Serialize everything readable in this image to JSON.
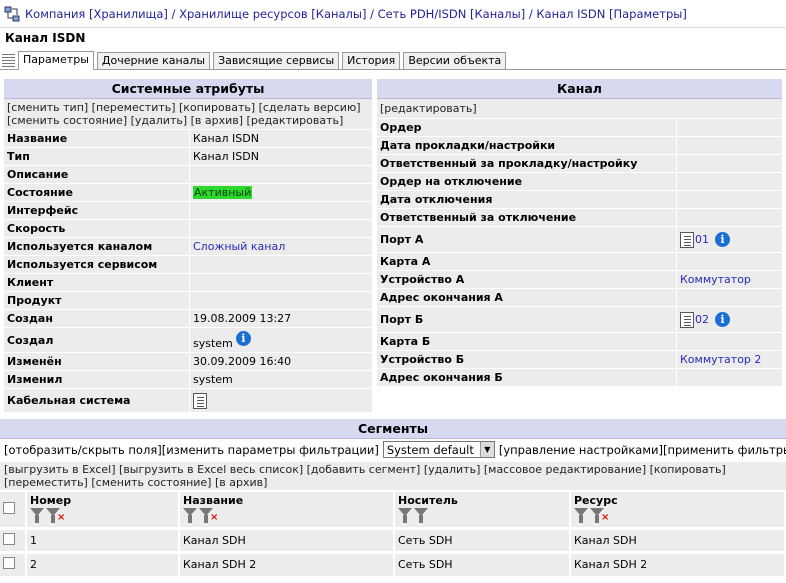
{
  "breadcrumb": "Компания [Хранилища] / Хранилище ресурсов [Каналы] / Сеть PDH/ISDN [Каналы] / Канал ISDN [Параметры]",
  "page_title": "Канал ISDN",
  "tabs": [
    {
      "label": "Параметры",
      "active": true
    },
    {
      "label": "Дочерние каналы",
      "active": false
    },
    {
      "label": "Зависящие сервисы",
      "active": false
    },
    {
      "label": "История",
      "active": false
    },
    {
      "label": "Версии объекта",
      "active": false
    }
  ],
  "sys": {
    "title": "Системные атрибуты",
    "actions_line1": "[сменить тип] [переместить] [копировать] [сделать версию]",
    "actions_line2": "[сменить состояние] [удалить] [в архив] [редактировать]",
    "rows": [
      {
        "label": "Название",
        "value": "Канал ISDN"
      },
      {
        "label": "Тип",
        "value": "Канал ISDN"
      },
      {
        "label": "Описание",
        "value": ""
      },
      {
        "label": "Состояние",
        "value": "Активный"
      },
      {
        "label": "Интерфейс",
        "value": ""
      },
      {
        "label": "Скорость",
        "value": ""
      },
      {
        "label": "Используется каналом",
        "value": "Сложный канал"
      },
      {
        "label": "Используется сервисом",
        "value": ""
      },
      {
        "label": "Клиент",
        "value": ""
      },
      {
        "label": "Продукт",
        "value": ""
      },
      {
        "label": "Создан",
        "value": "19.08.2009 13:27"
      },
      {
        "label": "Создал",
        "value": "system"
      },
      {
        "label": "Изменён",
        "value": "30.09.2009 16:40"
      },
      {
        "label": "Изменил",
        "value": "system"
      },
      {
        "label": "Кабельная система",
        "value": ""
      }
    ]
  },
  "chan": {
    "title": "Канал",
    "action": "[редактировать]",
    "rows": [
      {
        "label": "Ордер",
        "value": ""
      },
      {
        "label": "Дата прокладки/настройки",
        "value": ""
      },
      {
        "label": "Ответственный за прокладку/настройку",
        "value": ""
      },
      {
        "label": "Ордер на отключение",
        "value": ""
      },
      {
        "label": "Дата отключения",
        "value": ""
      },
      {
        "label": "Ответственный за отключение",
        "value": ""
      },
      {
        "label": "Порт А",
        "value": "01"
      },
      {
        "label": "Карта А",
        "value": ""
      },
      {
        "label": "Устройство А",
        "value": "Коммутатор"
      },
      {
        "label": "Адрес окончания А",
        "value": ""
      },
      {
        "label": "Порт Б",
        "value": "02"
      },
      {
        "label": "Карта Б",
        "value": ""
      },
      {
        "label": "Устройство Б",
        "value": "Коммутатор 2"
      },
      {
        "label": "Адрес окончания Б",
        "value": ""
      }
    ]
  },
  "segments": {
    "title": "Сегменты",
    "filter_left": "[отобразить/скрыть поля][изменить параметры фильтрации]",
    "select_value": "System default",
    "filter_right": "[управление настройками][применить фильтры]",
    "actions_line1": "[выгрузить в Excel] [выгрузить в Excel весь список] [добавить сегмент] [удалить] [массовое редактирование] [копировать]",
    "actions_line2": "[переместить] [сменить состояние] [в архив]",
    "columns": [
      "Номер",
      "Название",
      "Носитель",
      "Ресурс"
    ],
    "rows": [
      {
        "num": "1",
        "name": "Канал SDH",
        "carrier": "Сеть SDH",
        "resource": "Канал SDH"
      },
      {
        "num": "2",
        "name": "Канал SDH 2",
        "carrier": "Сеть SDH",
        "resource": "Канал SDH 2"
      }
    ]
  }
}
